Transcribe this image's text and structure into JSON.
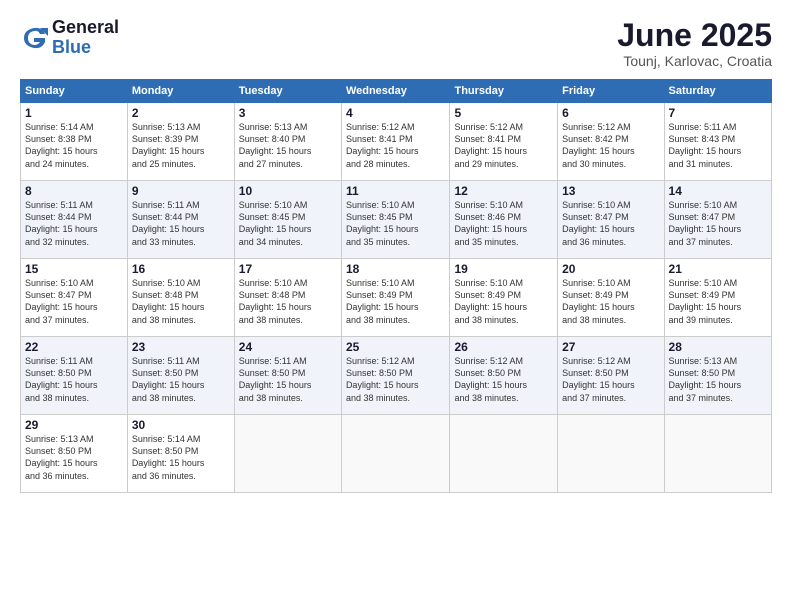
{
  "logo": {
    "general": "General",
    "blue": "Blue"
  },
  "title": "June 2025",
  "location": "Tounj, Karlovac, Croatia",
  "days_of_week": [
    "Sunday",
    "Monday",
    "Tuesday",
    "Wednesday",
    "Thursday",
    "Friday",
    "Saturday"
  ],
  "weeks": [
    [
      {
        "day": "1",
        "info": "Sunrise: 5:14 AM\nSunset: 8:38 PM\nDaylight: 15 hours\nand 24 minutes."
      },
      {
        "day": "2",
        "info": "Sunrise: 5:13 AM\nSunset: 8:39 PM\nDaylight: 15 hours\nand 25 minutes."
      },
      {
        "day": "3",
        "info": "Sunrise: 5:13 AM\nSunset: 8:40 PM\nDaylight: 15 hours\nand 27 minutes."
      },
      {
        "day": "4",
        "info": "Sunrise: 5:12 AM\nSunset: 8:41 PM\nDaylight: 15 hours\nand 28 minutes."
      },
      {
        "day": "5",
        "info": "Sunrise: 5:12 AM\nSunset: 8:41 PM\nDaylight: 15 hours\nand 29 minutes."
      },
      {
        "day": "6",
        "info": "Sunrise: 5:12 AM\nSunset: 8:42 PM\nDaylight: 15 hours\nand 30 minutes."
      },
      {
        "day": "7",
        "info": "Sunrise: 5:11 AM\nSunset: 8:43 PM\nDaylight: 15 hours\nand 31 minutes."
      }
    ],
    [
      {
        "day": "8",
        "info": "Sunrise: 5:11 AM\nSunset: 8:44 PM\nDaylight: 15 hours\nand 32 minutes."
      },
      {
        "day": "9",
        "info": "Sunrise: 5:11 AM\nSunset: 8:44 PM\nDaylight: 15 hours\nand 33 minutes."
      },
      {
        "day": "10",
        "info": "Sunrise: 5:10 AM\nSunset: 8:45 PM\nDaylight: 15 hours\nand 34 minutes."
      },
      {
        "day": "11",
        "info": "Sunrise: 5:10 AM\nSunset: 8:45 PM\nDaylight: 15 hours\nand 35 minutes."
      },
      {
        "day": "12",
        "info": "Sunrise: 5:10 AM\nSunset: 8:46 PM\nDaylight: 15 hours\nand 35 minutes."
      },
      {
        "day": "13",
        "info": "Sunrise: 5:10 AM\nSunset: 8:47 PM\nDaylight: 15 hours\nand 36 minutes."
      },
      {
        "day": "14",
        "info": "Sunrise: 5:10 AM\nSunset: 8:47 PM\nDaylight: 15 hours\nand 37 minutes."
      }
    ],
    [
      {
        "day": "15",
        "info": "Sunrise: 5:10 AM\nSunset: 8:47 PM\nDaylight: 15 hours\nand 37 minutes."
      },
      {
        "day": "16",
        "info": "Sunrise: 5:10 AM\nSunset: 8:48 PM\nDaylight: 15 hours\nand 38 minutes."
      },
      {
        "day": "17",
        "info": "Sunrise: 5:10 AM\nSunset: 8:48 PM\nDaylight: 15 hours\nand 38 minutes."
      },
      {
        "day": "18",
        "info": "Sunrise: 5:10 AM\nSunset: 8:49 PM\nDaylight: 15 hours\nand 38 minutes."
      },
      {
        "day": "19",
        "info": "Sunrise: 5:10 AM\nSunset: 8:49 PM\nDaylight: 15 hours\nand 38 minutes."
      },
      {
        "day": "20",
        "info": "Sunrise: 5:10 AM\nSunset: 8:49 PM\nDaylight: 15 hours\nand 38 minutes."
      },
      {
        "day": "21",
        "info": "Sunrise: 5:10 AM\nSunset: 8:49 PM\nDaylight: 15 hours\nand 39 minutes."
      }
    ],
    [
      {
        "day": "22",
        "info": "Sunrise: 5:11 AM\nSunset: 8:50 PM\nDaylight: 15 hours\nand 38 minutes."
      },
      {
        "day": "23",
        "info": "Sunrise: 5:11 AM\nSunset: 8:50 PM\nDaylight: 15 hours\nand 38 minutes."
      },
      {
        "day": "24",
        "info": "Sunrise: 5:11 AM\nSunset: 8:50 PM\nDaylight: 15 hours\nand 38 minutes."
      },
      {
        "day": "25",
        "info": "Sunrise: 5:12 AM\nSunset: 8:50 PM\nDaylight: 15 hours\nand 38 minutes."
      },
      {
        "day": "26",
        "info": "Sunrise: 5:12 AM\nSunset: 8:50 PM\nDaylight: 15 hours\nand 38 minutes."
      },
      {
        "day": "27",
        "info": "Sunrise: 5:12 AM\nSunset: 8:50 PM\nDaylight: 15 hours\nand 37 minutes."
      },
      {
        "day": "28",
        "info": "Sunrise: 5:13 AM\nSunset: 8:50 PM\nDaylight: 15 hours\nand 37 minutes."
      }
    ],
    [
      {
        "day": "29",
        "info": "Sunrise: 5:13 AM\nSunset: 8:50 PM\nDaylight: 15 hours\nand 36 minutes."
      },
      {
        "day": "30",
        "info": "Sunrise: 5:14 AM\nSunset: 8:50 PM\nDaylight: 15 hours\nand 36 minutes."
      },
      {
        "day": "",
        "info": ""
      },
      {
        "day": "",
        "info": ""
      },
      {
        "day": "",
        "info": ""
      },
      {
        "day": "",
        "info": ""
      },
      {
        "day": "",
        "info": ""
      }
    ]
  ]
}
